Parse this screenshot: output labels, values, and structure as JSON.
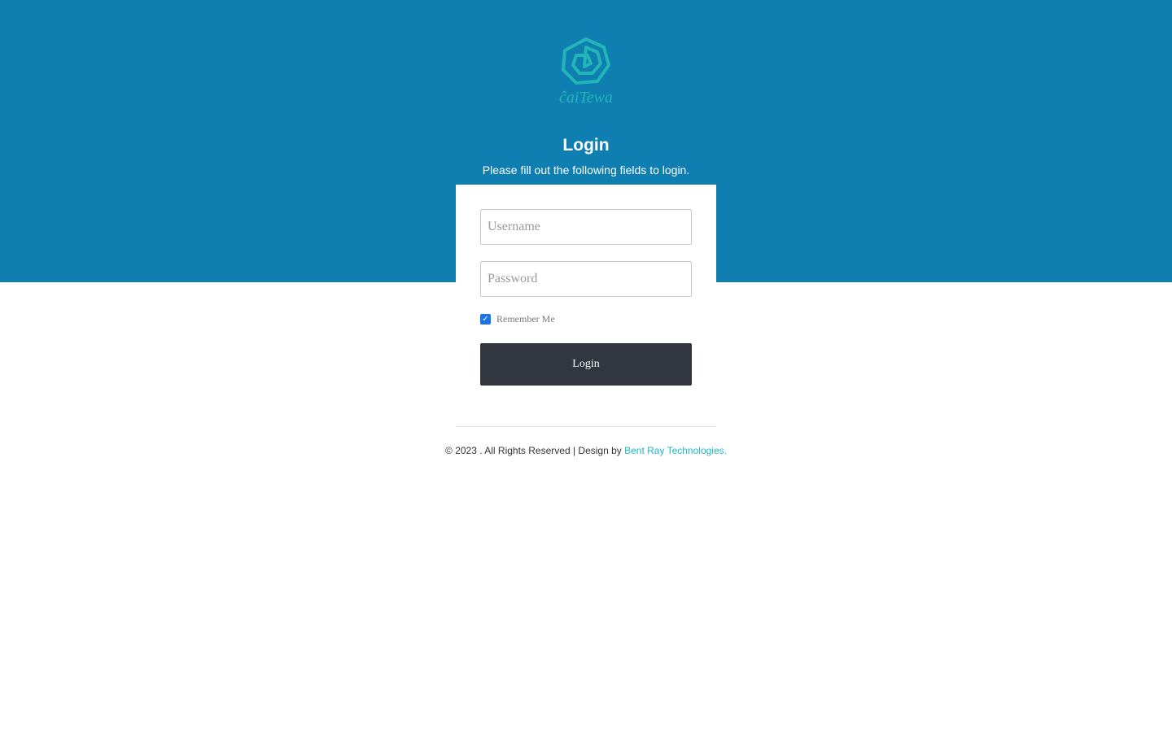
{
  "brand": {
    "logo_icon": "spiral-logo-icon",
    "logo_text": "ĉaiTewa",
    "colors": {
      "hero": "#0e7fb0",
      "logo": "#24b5b8",
      "button": "#32363f",
      "link": "#20b8c4",
      "checkbox": "#1a73e8"
    }
  },
  "header": {
    "title": "Login",
    "subtitle": "Please fill out the following fields to login."
  },
  "form": {
    "username_placeholder": "Username",
    "username_value": "",
    "password_placeholder": "Password",
    "password_value": "",
    "remember_label": "Remember Me",
    "remember_checked": true,
    "submit_label": "Login"
  },
  "footer": {
    "copyright": "© 2023 . All Rights Reserved | Design by ",
    "link_text": "Bent Ray Technologies."
  }
}
